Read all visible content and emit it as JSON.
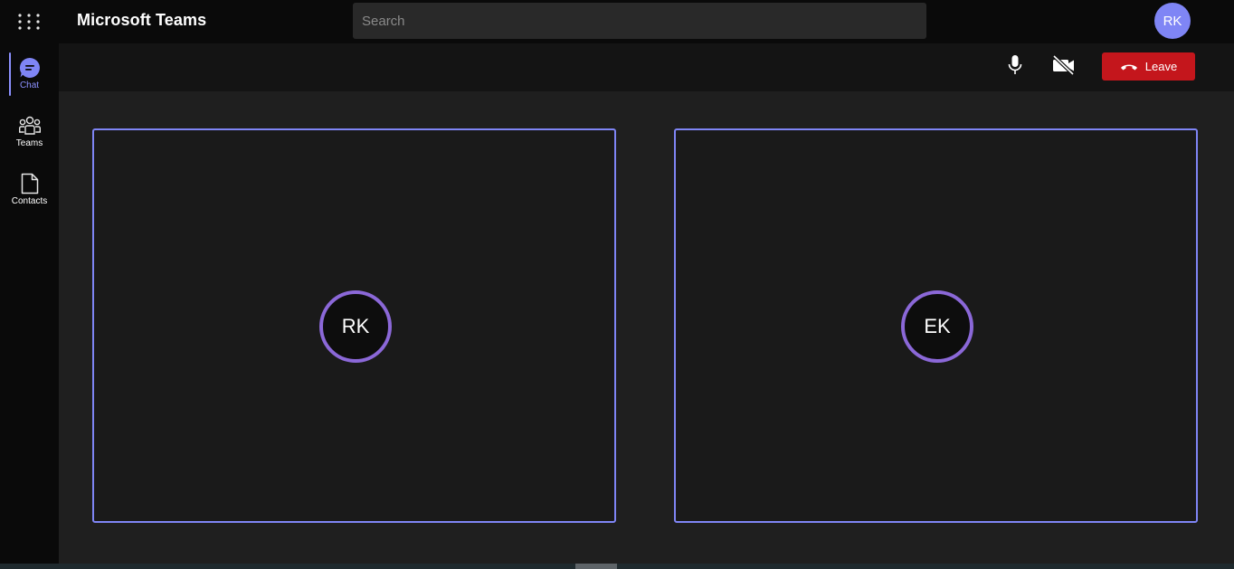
{
  "app": {
    "title": "Microsoft Teams"
  },
  "search": {
    "placeholder": "Search",
    "value": ""
  },
  "user": {
    "initials": "RK",
    "avatar_color": "#7f85f5"
  },
  "rail": {
    "items": [
      {
        "label": "Chat",
        "icon": "chat-icon",
        "active": true
      },
      {
        "label": "Teams",
        "icon": "teams-icon",
        "active": false
      },
      {
        "label": "Contacts",
        "icon": "document-icon",
        "active": false
      }
    ]
  },
  "toolbar": {
    "mic_icon": "microphone-icon",
    "camera_icon": "camera-off-icon",
    "leave_label": "Leave",
    "leave_icon": "hang-up-icon",
    "leave_color": "#c4161c"
  },
  "participants": [
    {
      "initials": "RK"
    },
    {
      "initials": "EK"
    }
  ],
  "colors": {
    "accent": "#7f85f5",
    "avatar_ring": "#8b68d8",
    "background": "#1f1f1f"
  }
}
